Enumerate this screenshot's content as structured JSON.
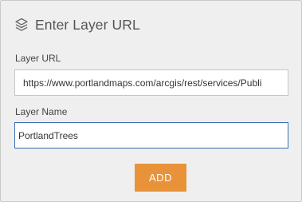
{
  "dialog": {
    "title": "Enter Layer URL",
    "icon": "layers-icon"
  },
  "form": {
    "url_label": "Layer URL",
    "url_value": "https://www.portlandmaps.com/arcgis/rest/services/Publi",
    "name_label": "Layer Name",
    "name_value": "PortlandTrees"
  },
  "actions": {
    "add_label": "ADD"
  },
  "colors": {
    "accent": "#e8923a",
    "focus_border": "#3a6fb0",
    "panel_bg": "#efefef"
  }
}
